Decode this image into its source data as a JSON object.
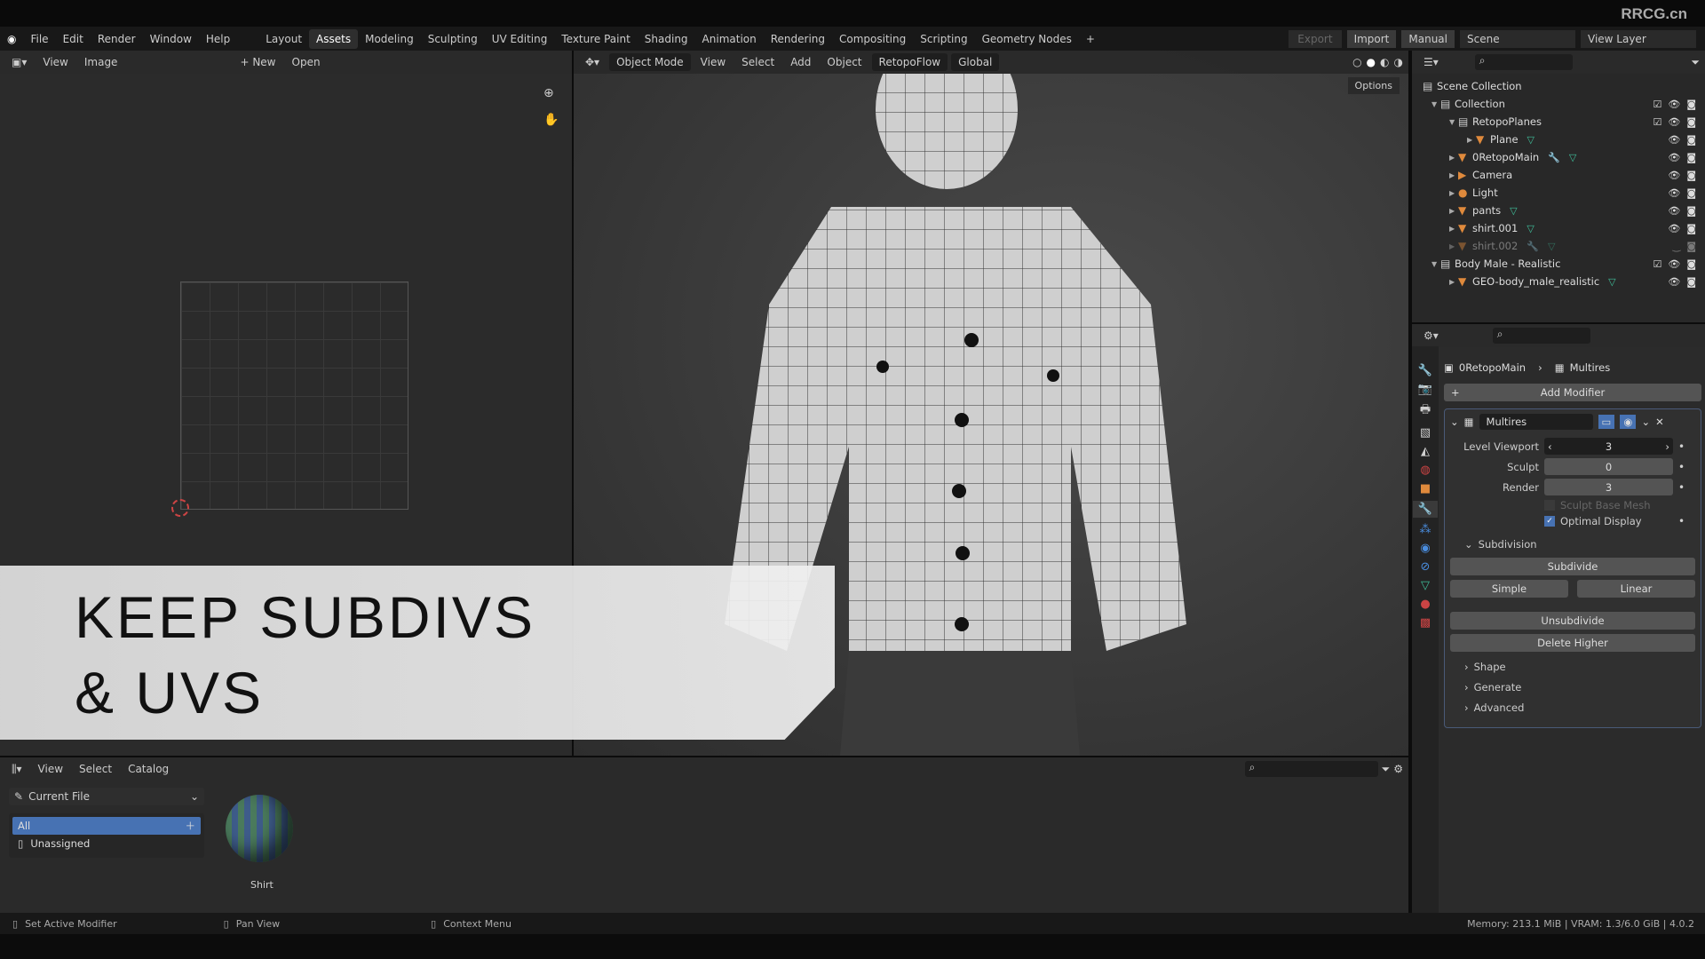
{
  "watermark": "RRCG.cn",
  "menu": [
    "File",
    "Edit",
    "Render",
    "Window",
    "Help"
  ],
  "workspaces": [
    "Layout",
    "Assets",
    "Modeling",
    "Sculpting",
    "UV Editing",
    "Texture Paint",
    "Shading",
    "Animation",
    "Rendering",
    "Compositing",
    "Scripting",
    "Geometry Nodes",
    "+"
  ],
  "active_workspace": "Assets",
  "topright": {
    "export": "Export",
    "import": "Import",
    "manual": "Manual",
    "scene": "Scene",
    "view_layer": "View Layer"
  },
  "uv_editor": {
    "menus": [
      "View",
      "Image"
    ],
    "new": "+ New",
    "open": "Open"
  },
  "viewport": {
    "mode": "Object Mode",
    "menus": [
      "View",
      "Select",
      "Add",
      "Object"
    ],
    "addon": "RetopoFlow",
    "orientation": "Global",
    "options": "Options"
  },
  "caption": {
    "line1": "KEEP SUBDIVS",
    "line2": "& UVS"
  },
  "outliner": {
    "root": "Scene Collection",
    "items": [
      {
        "name": "Collection",
        "depth": 0,
        "type": "collection",
        "check": true
      },
      {
        "name": "RetopoPlanes",
        "depth": 1,
        "type": "collection",
        "check": true
      },
      {
        "name": "Plane",
        "depth": 2,
        "type": "mesh"
      },
      {
        "name": "0RetopoMain",
        "depth": 1,
        "type": "mesh",
        "mod": true
      },
      {
        "name": "Camera",
        "depth": 1,
        "type": "camera"
      },
      {
        "name": "Light",
        "depth": 1,
        "type": "light"
      },
      {
        "name": "pants",
        "depth": 1,
        "type": "mesh"
      },
      {
        "name": "shirt.001",
        "depth": 1,
        "type": "mesh"
      },
      {
        "name": "shirt.002",
        "depth": 1,
        "type": "mesh",
        "hidden": true,
        "mod": true
      },
      {
        "name": "Body Male - Realistic",
        "depth": 0,
        "type": "collection",
        "check": true
      },
      {
        "name": "GEO-body_male_realistic",
        "depth": 1,
        "type": "mesh"
      }
    ]
  },
  "properties": {
    "breadcrumb_object": "0RetopoMain",
    "breadcrumb_modifier": "Multires",
    "add_modifier": "Add Modifier",
    "modifier_name": "Multires",
    "level_viewport_label": "Level Viewport",
    "level_viewport": "3",
    "sculpt_label": "Sculpt",
    "sculpt": "0",
    "render_label": "Render",
    "render": "3",
    "sculpt_base_mesh": "Sculpt Base Mesh",
    "optimal_display": "Optimal Display",
    "subdivision": "Subdivision",
    "subdivide": "Subdivide",
    "simple": "Simple",
    "linear": "Linear",
    "unsubdivide": "Unsubdivide",
    "delete_higher": "Delete Higher",
    "sections": [
      "Shape",
      "Generate",
      "Advanced"
    ]
  },
  "asset_browser": {
    "menus": [
      "View",
      "Select",
      "Catalog"
    ],
    "library": "Current File",
    "catalogs": [
      "All",
      "Unassigned"
    ],
    "asset": "Shirt"
  },
  "status": {
    "left": "Set Active Modifier",
    "middle": "Pan View",
    "right": "Context Menu",
    "info": "Memory: 213.1 MiB | VRAM: 1.3/6.0 GiB | 4.0.2"
  },
  "colors": {
    "accent": "#4772b3",
    "object_orange": "#e08a3c",
    "mesh_green": "#3fbf9a"
  }
}
